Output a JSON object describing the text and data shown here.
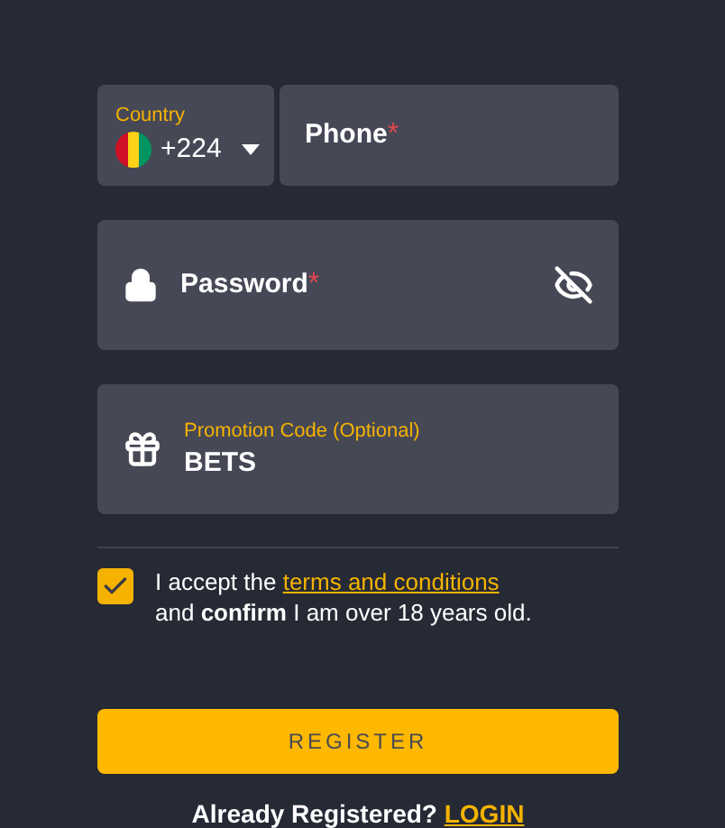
{
  "country": {
    "label": "Country",
    "code": "+224"
  },
  "phone": {
    "placeholder": "Phone",
    "required_mark": "*"
  },
  "password": {
    "placeholder": "Password",
    "required_mark": "*",
    "visible": false
  },
  "promo": {
    "label": "Promotion Code (Optional)",
    "value": "BETS"
  },
  "terms": {
    "checked": true,
    "prefix": "I accept the",
    "link": "terms and conditions",
    "suffix": "and **confirm** I am over 18 years old."
  },
  "register_button": "REGISTER",
  "login": {
    "text": "Already Registered?",
    "link": "LOGIN"
  }
}
